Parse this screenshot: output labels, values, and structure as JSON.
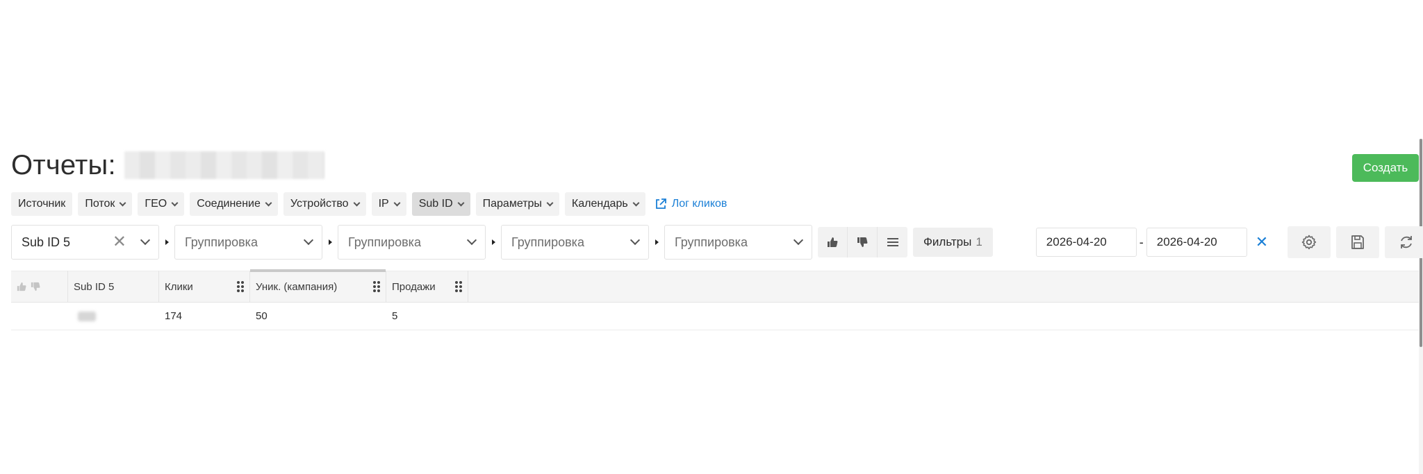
{
  "page": {
    "title": "Отчеты:",
    "create_label": "Создать"
  },
  "chips": [
    {
      "label": "Источник",
      "has_chevron": false
    },
    {
      "label": "Поток",
      "has_chevron": true
    },
    {
      "label": "ГЕО",
      "has_chevron": true
    },
    {
      "label": "Соединение",
      "has_chevron": true
    },
    {
      "label": "Устройство",
      "has_chevron": true
    },
    {
      "label": "IP",
      "has_chevron": true
    },
    {
      "label": "Sub ID",
      "has_chevron": true,
      "active": true
    },
    {
      "label": "Параметры",
      "has_chevron": true
    },
    {
      "label": "Календарь",
      "has_chevron": true
    }
  ],
  "log_link": {
    "label": "Лог кликов",
    "icon": "external-link-icon"
  },
  "grouping": {
    "selects": [
      {
        "value": "Sub ID 5",
        "placeholder": ""
      },
      {
        "value": "",
        "placeholder": "Группировка"
      },
      {
        "value": "",
        "placeholder": "Группировка"
      },
      {
        "value": "",
        "placeholder": "Группировка"
      },
      {
        "value": "",
        "placeholder": "Группировка"
      }
    ]
  },
  "filters": {
    "label": "Фильтры",
    "count": "1"
  },
  "dates": {
    "from": "2026-04-20",
    "separator": "-",
    "to": "2026-04-20"
  },
  "table": {
    "columns": [
      "Sub ID 5",
      "Клики",
      "Уник. (кампания)",
      "Продажи"
    ],
    "rows": [
      {
        "sub_id": "",
        "clicks": "174",
        "unique": "50",
        "sales": "5"
      }
    ]
  },
  "colors": {
    "accent": "#4cba5a",
    "link": "#1a7fd6"
  }
}
